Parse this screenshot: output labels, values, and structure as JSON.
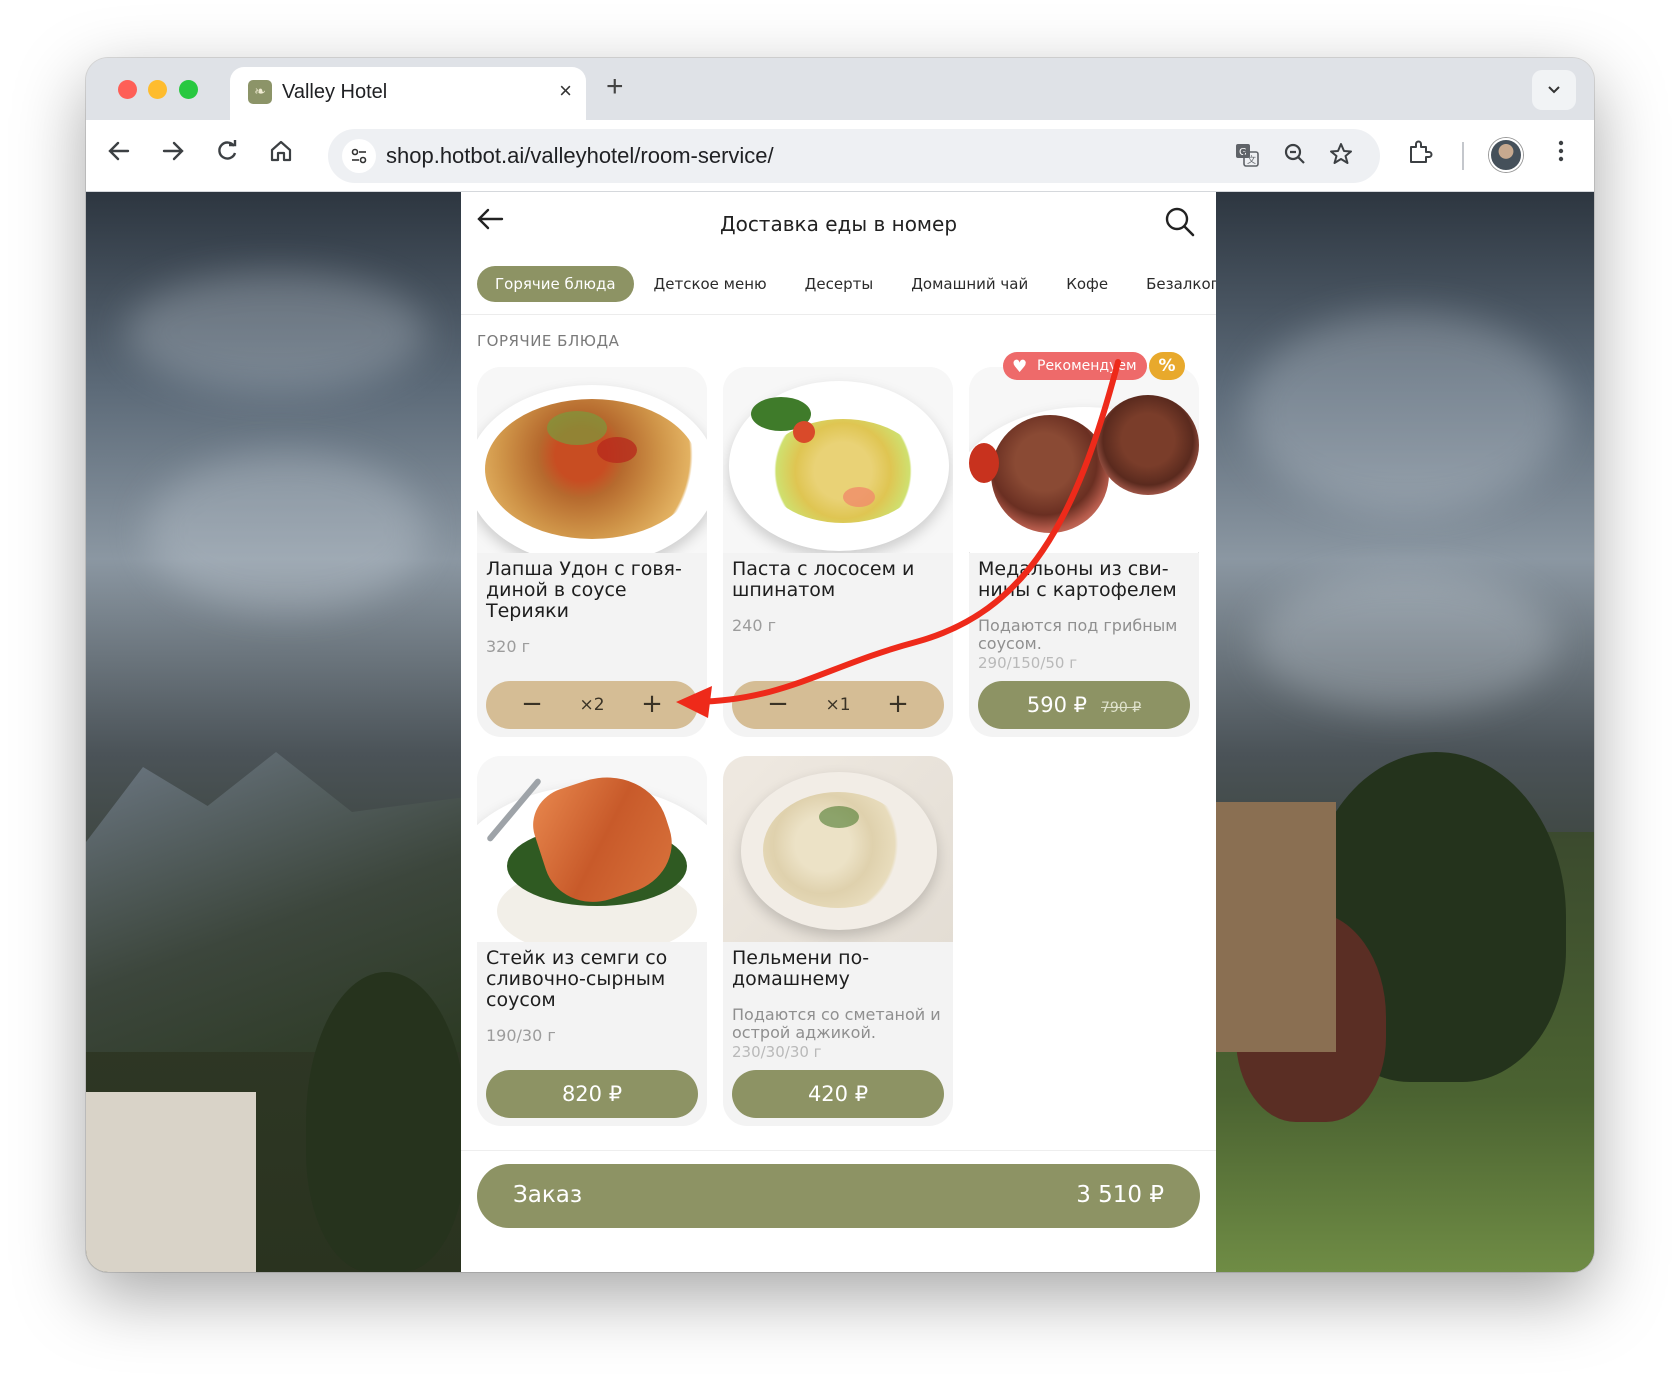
{
  "browser": {
    "tab_title": "Valley Hotel",
    "tab_close": "×",
    "new_tab": "+",
    "url": "shop.hotbot.ai/valleyhotel/room-service/"
  },
  "app": {
    "title": "Доставка еды в номер",
    "categories": [
      {
        "label": "Горячие блюда",
        "active": true
      },
      {
        "label": "Детское меню",
        "active": false
      },
      {
        "label": "Десерты",
        "active": false
      },
      {
        "label": "Домашний чай",
        "active": false
      },
      {
        "label": "Кофе",
        "active": false
      },
      {
        "label": "Безалкогольные",
        "active": false
      }
    ],
    "section_title": "ГОРЯЧИЕ БЛЮДА",
    "badges": {
      "recommended": "Рекомендуем",
      "discount": "%"
    },
    "products": [
      {
        "name": "Лапша Удон с говя-диной в соусе Терияки",
        "weight": "320 г",
        "stepper": {
          "minus": "−",
          "count": "×2",
          "plus": "+"
        }
      },
      {
        "name": "Паста с лососем и шпинатом",
        "weight": "240 г",
        "stepper": {
          "minus": "−",
          "count": "×1",
          "plus": "+"
        }
      },
      {
        "name": "Медальоны из сви-нины с картофелем",
        "description": "Подаются под грибным соусом.",
        "weight": "290/150/50 г",
        "price": "590 ₽",
        "old_price": "790 ₽"
      },
      {
        "name": "Стейк из семги со сливочно-сырным соусом",
        "weight": "190/30 г",
        "price": "820 ₽"
      },
      {
        "name": "Пельмени по-домашнему",
        "description": "Подаются со сметаной и острой аджикой.",
        "weight": "230/30/30 г",
        "price": "420 ₽"
      }
    ],
    "order": {
      "label": "Заказ",
      "total": "3 510 ₽"
    }
  },
  "colors": {
    "accent": "#8d9364",
    "stepper": "#d5bd95",
    "recommended_badge": "#ee6a6a",
    "discount_badge": "#e8a92c",
    "annotation_arrow": "#ee2a1a"
  },
  "icons": [
    "back-arrow-icon",
    "forward-arrow-icon",
    "reload-icon",
    "home-icon",
    "site-settings-icon",
    "translate-icon",
    "zoom-icon",
    "bookmark-star-icon",
    "extensions-icon",
    "kebab-menu-icon",
    "search-icon",
    "heart-icon"
  ]
}
